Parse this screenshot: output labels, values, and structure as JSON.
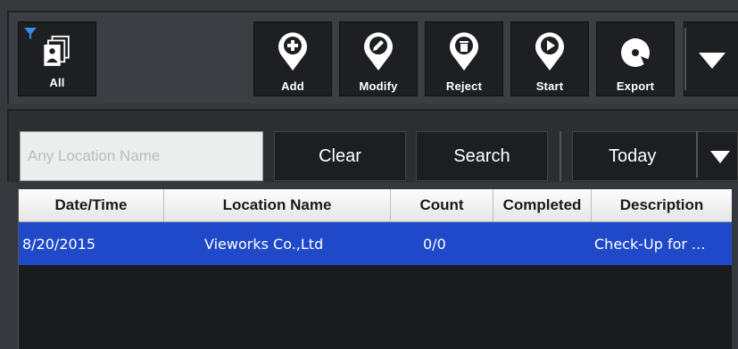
{
  "toolbar": {
    "all_label": "All",
    "buttons": [
      {
        "label": "Add",
        "icon": "plus-icon"
      },
      {
        "label": "Modify",
        "icon": "pencil-icon"
      },
      {
        "label": "Reject",
        "icon": "trash-icon"
      },
      {
        "label": "Start",
        "icon": "play-icon"
      },
      {
        "label": "Export",
        "icon": "disc-icon"
      }
    ]
  },
  "filter": {
    "placeholder": "Any Location Name",
    "clear_label": "Clear",
    "search_label": "Search",
    "period_label": "Today"
  },
  "table": {
    "columns": [
      "Date/Time",
      "Location Name",
      "Count",
      "Completed",
      "Description"
    ],
    "rows": [
      {
        "date": "8/20/2015",
        "location": "Vieworks Co.,Ltd",
        "count": "0/0",
        "completed": "",
        "description": "Check-Up for ..."
      }
    ]
  },
  "colors": {
    "selected_row": "#1f49c9",
    "toolbar_bg": "#1d1f22",
    "accent_blue": "#2f7fd6"
  }
}
